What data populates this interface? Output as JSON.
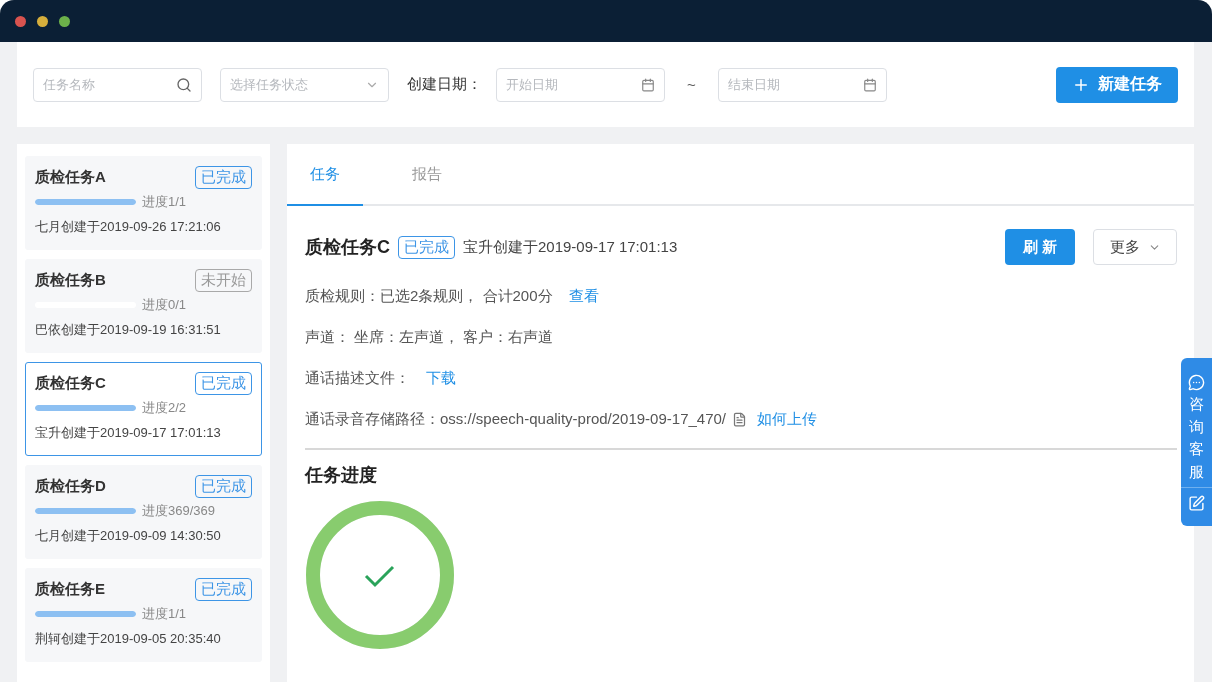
{
  "filters": {
    "task_name": {
      "placeholder": "任务名称"
    },
    "status": {
      "placeholder": "选择任务状态"
    },
    "date_label": "创建日期：",
    "start_date": {
      "placeholder": "开始日期"
    },
    "separator": "~",
    "end_date": {
      "placeholder": "结束日期"
    },
    "new_button": "新建任务"
  },
  "tasks": [
    {
      "name": "质检任务A",
      "status": {
        "label": "已完成",
        "kind": "done"
      },
      "level": 1,
      "progress": "进度1/1",
      "created": "七月创建于2019-09-26 17:21:06",
      "selected": false
    },
    {
      "name": "质检任务B",
      "status": {
        "label": "未开始",
        "kind": "pending"
      },
      "level": 0,
      "progress": "进度0/1",
      "created": "巴依创建于2019-09-19 16:31:51",
      "selected": false
    },
    {
      "name": "质检任务C",
      "status": {
        "label": "已完成",
        "kind": "done"
      },
      "level": 1,
      "progress": "进度2/2",
      "created": "宝升创建于2019-09-17 17:01:13",
      "selected": true
    },
    {
      "name": "质检任务D",
      "status": {
        "label": "已完成",
        "kind": "done"
      },
      "level": 1,
      "progress": "进度369/369",
      "created": "七月创建于2019-09-09 14:30:50",
      "selected": false
    },
    {
      "name": "质检任务E",
      "status": {
        "label": "已完成",
        "kind": "done"
      },
      "level": 1,
      "progress": "进度1/1",
      "created": "荆轲创建于2019-09-05 20:35:40",
      "selected": false
    }
  ],
  "detail": {
    "tabs": [
      {
        "label": "任务",
        "selected": true
      },
      {
        "label": "报告",
        "selected": false
      }
    ],
    "title": "质检任务C",
    "status": {
      "label": "已完成",
      "kind": "done"
    },
    "created": "宝升创建于2019-09-17 17:01:13",
    "actions": {
      "refresh": "刷 新",
      "more": "更多"
    },
    "fields": [
      {
        "kind": "plain",
        "text": "质检规则：已选2条规则， 合计200分",
        "link": "查看"
      },
      {
        "kind": "plain",
        "text": "声道： 坐席：左声道， 客户：右声道"
      },
      {
        "kind": "plain",
        "text": "通话描述文件：",
        "link": "下载"
      },
      {
        "kind": "file",
        "text": "通话录音存储路径：oss://speech-quality-prod/2019-09-17_470/",
        "link": "如何上传"
      }
    ],
    "progress": {
      "title": "任务进度",
      "level": 1,
      "kind": "done"
    }
  },
  "service": {
    "label": "咨询客服"
  }
}
